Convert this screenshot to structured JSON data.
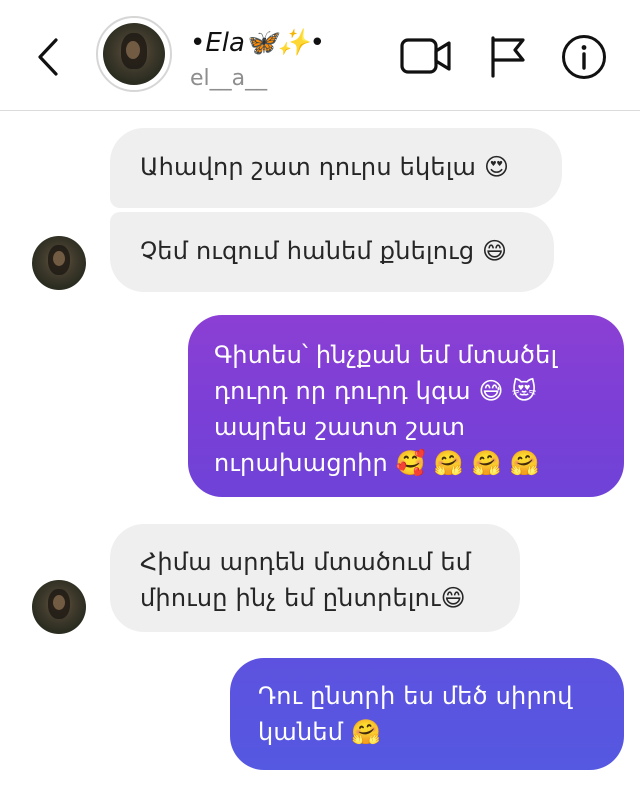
{
  "header": {
    "name": "•Ela🦋✨•",
    "username": "el__a__"
  },
  "icons": {
    "back": "chevron-left-icon",
    "video": "video-camera-icon",
    "flag": "flag-icon",
    "info": "info-icon"
  },
  "colors": {
    "received_bubble": "#efefef",
    "sent_gradient_top": "#8c3fd4",
    "sent_gradient_bottom": "#5558e1",
    "header_border": "#dbdbdb"
  },
  "messages": [
    {
      "direction": "received",
      "text": "Ահավոր շատ դուրս եկելա 😍"
    },
    {
      "direction": "received",
      "text": "Չեմ ուզում հանեմ քնելուց 😄"
    },
    {
      "direction": "sent",
      "text": "Գիտես՝ ինչքան եմ մտածել դուրդ որ դուրդ կգա 😅 😻 ապրես շատտ շատ ուրախացրիր 🥰 🤗 🤗 🤗"
    },
    {
      "direction": "received",
      "text": "Հիմա արդեն մտածում եմ միուսը ինչ եմ ընտրելու😄"
    },
    {
      "direction": "sent",
      "text": "Դու ընտրի ես մեծ սիրով կանեմ 🤗"
    }
  ]
}
